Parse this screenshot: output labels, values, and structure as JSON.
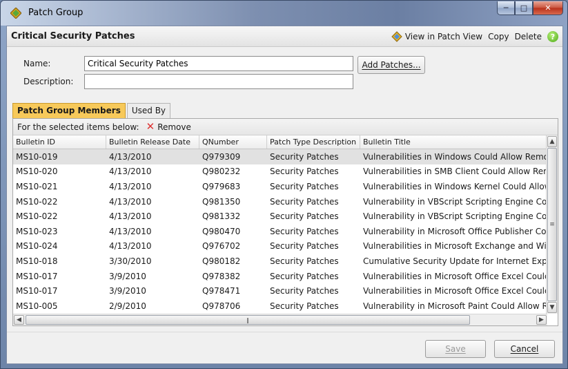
{
  "window": {
    "title": "Patch Group"
  },
  "header": {
    "title": "Critical Security Patches",
    "view_in_patch_view": "View in Patch View",
    "copy": "Copy",
    "delete": "Delete",
    "help": "?"
  },
  "form": {
    "name_label": "Name:",
    "name_value": "Critical Security Patches",
    "description_label": "Description:",
    "description_value": "",
    "add_patches": "Add Patches..."
  },
  "tabs": [
    {
      "label": "Patch Group Members",
      "active": true
    },
    {
      "label": "Used By",
      "active": false
    }
  ],
  "toolbar": {
    "selected_label": "For the selected items below:",
    "remove": "Remove"
  },
  "columns": [
    "Bulletin ID",
    "Bulletin Release Date",
    "QNumber",
    "Patch Type Description",
    "Bulletin Title"
  ],
  "rows": [
    [
      "MS10-019",
      "4/13/2010",
      "Q979309",
      "Security Patches",
      "Vulnerabilities in Windows Could Allow Remote C"
    ],
    [
      "MS10-020",
      "4/13/2010",
      "Q980232",
      "Security Patches",
      "Vulnerabilities in SMB Client Could Allow Remote"
    ],
    [
      "MS10-021",
      "4/13/2010",
      "Q979683",
      "Security Patches",
      "Vulnerabilities in Windows Kernel Could Allow Ele"
    ],
    [
      "MS10-022",
      "4/13/2010",
      "Q981350",
      "Security Patches",
      "Vulnerability in VBScript Scripting Engine Could A"
    ],
    [
      "MS10-022",
      "4/13/2010",
      "Q981332",
      "Security Patches",
      "Vulnerability in VBScript Scripting Engine Could A"
    ],
    [
      "MS10-023",
      "4/13/2010",
      "Q980470",
      "Security Patches",
      "Vulnerability in Microsoft Office Publisher Could"
    ],
    [
      "MS10-024",
      "4/13/2010",
      "Q976702",
      "Security Patches",
      "Vulnerabilities in Microsoft Exchange and Windo"
    ],
    [
      "MS10-018",
      "3/30/2010",
      "Q980182",
      "Security Patches",
      "Cumulative Security Update for Internet Explorer"
    ],
    [
      "MS10-017",
      "3/9/2010",
      "Q978382",
      "Security Patches",
      "Vulnerabilities in Microsoft Office Excel Could All"
    ],
    [
      "MS10-017",
      "3/9/2010",
      "Q978471",
      "Security Patches",
      "Vulnerabilities in Microsoft Office Excel Could All"
    ],
    [
      "MS10-005",
      "2/9/2010",
      "Q978706",
      "Security Patches",
      "Vulnerability in Microsoft Paint Could Allow Rem"
    ]
  ],
  "footer": {
    "save": "Save",
    "cancel": "Cancel"
  },
  "icons": {
    "app": "diamond-icon",
    "patch_view": "patch-view-icon",
    "help": "help-icon",
    "remove": "remove-x-icon"
  }
}
